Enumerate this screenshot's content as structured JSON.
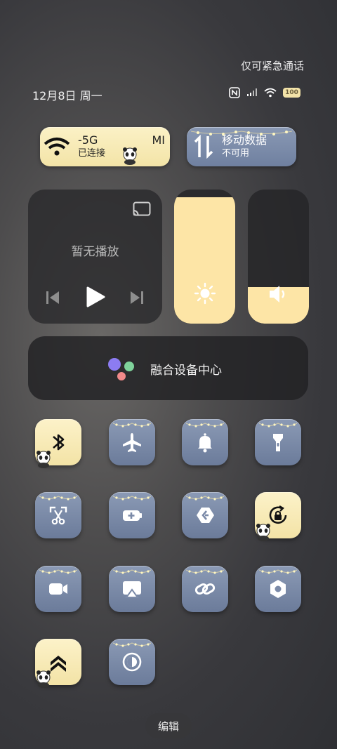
{
  "status_bar": {
    "emergency_text": "仅可紧急通话",
    "date_text": "12月8日 周一",
    "battery_level": "100"
  },
  "quick_pills": {
    "wifi": {
      "name": "-5G",
      "name_suffix": "MI",
      "status": "已连接",
      "active": true
    },
    "mobile_data": {
      "name": "移动数据",
      "status": "不可用",
      "active": false
    }
  },
  "media": {
    "title": "暂无播放"
  },
  "sliders": {
    "brightness": {
      "level_percent": 94,
      "icon": "sun-icon"
    },
    "volume": {
      "level_percent": 27,
      "icon": "speaker-icon"
    }
  },
  "fusion_center": {
    "label": "融合设备中心"
  },
  "tiles": [
    {
      "icon": "bluetooth-icon",
      "active": true
    },
    {
      "icon": "airplane-icon",
      "active": false
    },
    {
      "icon": "bell-icon",
      "active": false
    },
    {
      "icon": "flashlight-icon",
      "active": false
    },
    {
      "icon": "screenshot-scissors-icon",
      "active": false
    },
    {
      "icon": "battery-saver-icon",
      "active": false
    },
    {
      "icon": "nfc-share-icon",
      "active": false
    },
    {
      "icon": "rotation-lock-icon",
      "active": true
    },
    {
      "icon": "screen-record-icon",
      "active": false
    },
    {
      "icon": "screen-cast-icon",
      "active": false
    },
    {
      "icon": "link-icon",
      "active": false
    },
    {
      "icon": "settings-hex-icon",
      "active": false
    },
    {
      "icon": "performance-mode-icon",
      "active": true
    },
    {
      "icon": "dark-mode-icon",
      "active": false
    }
  ],
  "edit_button": {
    "label": "编辑"
  },
  "colors": {
    "accent_yellow": "#fde5a6",
    "tile_blue": "#7b8aa8"
  }
}
